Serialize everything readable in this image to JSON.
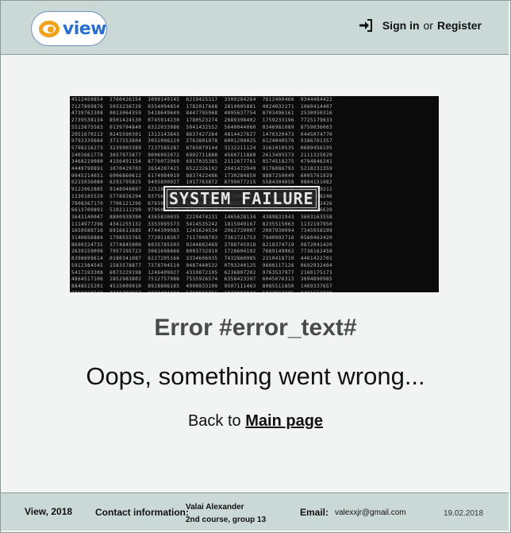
{
  "header": {
    "logo_text": "view",
    "sign_in": "Sign in",
    "or": "or",
    "register": "Register"
  },
  "hero": {
    "label": "SYSTEM FAILURE"
  },
  "main": {
    "error_title": "Error #error_text#",
    "message": "Oops, something went wrong...",
    "back_prefix": "Back to",
    "back_link": "Main page"
  },
  "footer": {
    "brand": "View, 2018",
    "contact_label": "Contact information:",
    "author_name": "Valai Alexander",
    "author_group": "2nd course, group 13",
    "email_label": "Email:",
    "email": "valexxjr@gmail.com",
    "date": "19.02.2018"
  },
  "colors": {
    "header_bg": "#cbd9d6",
    "page_bg": "#f1f4f3",
    "logo_orange": "#f0a21a",
    "logo_blue": "#2a6fcf"
  },
  "icons": {
    "sign_in": "sign-in-icon",
    "logo": "eye-icon"
  }
}
